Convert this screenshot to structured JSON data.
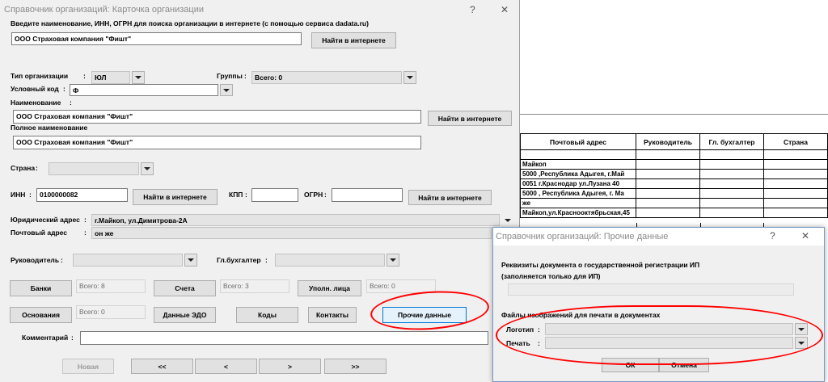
{
  "main": {
    "title": "Справочник организаций: Карточка организации",
    "help": "?",
    "close": "✕",
    "search_prompt": "Введите наименование, ИНН, ОГРН для поиска организации в интернете (с помощью сервиса dadata.ru)",
    "search_value": "ООО Страховая компания \"Фишт\"",
    "find_online": "Найти в интернете",
    "org_type_label": "Тип организации",
    "org_type_value": "ЮЛ",
    "groups_label": "Группы",
    "groups_value": "Всего: 0",
    "code_label": "Условный код",
    "code_value": "Ф",
    "name_label": "Наименование",
    "name_value": "ООО Страховая компания \"Фишт\"",
    "full_name_label": "Полное наименование",
    "full_name_value": "ООО Страховая компания \"Фишт\"",
    "country_label": "Страна",
    "inn_label": "ИНН",
    "inn_value": "0100000082",
    "kpp_label": "КПП",
    "ogrn_label": "ОГРН",
    "legal_address_label": "Юридический адрес",
    "legal_address_value": "г.Майкоп, ул.Димитрова-2А",
    "postal_address_label": "Почтовый адрес",
    "postal_address_value": "он же",
    "director_label": "Руководитель",
    "accountant_label": "Гл.бухгалтер",
    "banks": "Банки",
    "banks_count": "Всего: 8",
    "accounts": "Счета",
    "accounts_count": "Всего: 3",
    "authorized": "Уполн. лица",
    "authorized_count": "Всего: 0",
    "bases": "Основания",
    "bases_count": "Всего: 0",
    "edo": "Данные ЭДО",
    "codes": "Коды",
    "contacts": "Контакты",
    "other_data": "Прочие данные",
    "comment_label": "Комментарий",
    "new": "Новая",
    "first": "<<",
    "prev": "<",
    "next": ">",
    "last": ">>",
    "colon": ":"
  },
  "grid": {
    "headers": [
      "Почтовый адрес",
      "Руководитель",
      "Гл. бухгалтер",
      "Страна"
    ],
    "rows": [
      "",
      "Майкоп",
      "5000 ,Республика Адыгея, г.Май",
      "0051 г.Краснодар ул.Лузана 40",
      "5000 , Республика Адыгея, г. Ма",
      "же",
      "Майкоп,ул.Краснооктябрьская,45"
    ]
  },
  "dialog": {
    "title": "Справочник организаций: Прочие данные",
    "help": "?",
    "close": "✕",
    "ip_reg_label": "Реквизиты документа о государственной регистрации ИП",
    "ip_only_note": "(заполняется только для ИП)",
    "images_label": "Файлы изображений для печати в документах",
    "logo_label": "Логотип",
    "stamp_label": "Печать",
    "ok": "ОК",
    "cancel": "Отмена"
  }
}
